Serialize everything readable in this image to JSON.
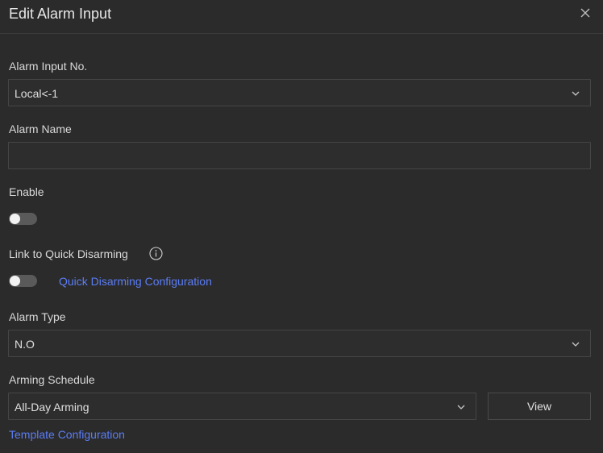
{
  "dialog": {
    "title": "Edit Alarm Input",
    "close_icon": "close-icon"
  },
  "alarm_input_no": {
    "label": "Alarm Input No.",
    "value": "Local<-1"
  },
  "alarm_name": {
    "label": "Alarm Name",
    "value": ""
  },
  "enable": {
    "label": "Enable",
    "on": false
  },
  "quick_disarming": {
    "label": "Link to Quick Disarming",
    "on": false,
    "config_link": "Quick Disarming Configuration",
    "info_icon": "info-icon"
  },
  "alarm_type": {
    "label": "Alarm Type",
    "value": "N.O"
  },
  "arming_schedule": {
    "label": "Arming Schedule",
    "value": "All-Day Arming",
    "view_button": "View",
    "template_link": "Template Configuration"
  },
  "colors": {
    "background": "#2b2b2b",
    "link": "#5b7df5",
    "toggle_off": "#5a5a5a"
  }
}
